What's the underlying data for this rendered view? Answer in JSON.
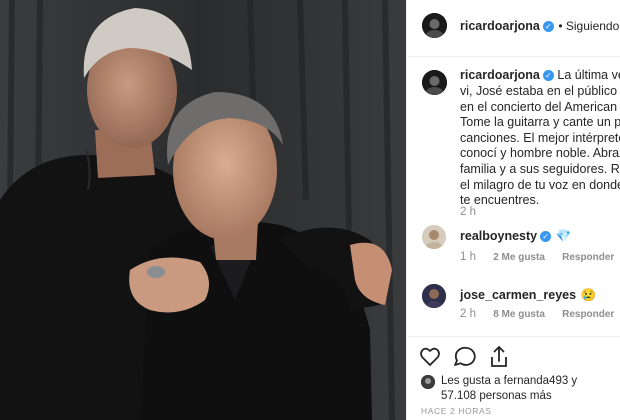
{
  "post": {
    "author": "ricardoarjona",
    "follow_status": "• Siguiendo",
    "caption_lines": [
      "La última vez que",
      "vi, José estaba en el público en M",
      "en el concierto del American Airli",
      "Tome la guitarra y cante un par d",
      "canciones. El mejor intérprete que",
      "conocí y hombre noble. Abrazo a",
      "familia y a sus seguidores. Recupe",
      "el milagro de tu voz en donde qu",
      "te encuentres."
    ],
    "caption_time": "2 h"
  },
  "comments": [
    {
      "user": "realboynesty",
      "emoji": "💎",
      "time": "1 h",
      "likes": "2 Me gusta",
      "reply": "Responder"
    },
    {
      "user": "jose_carmen_reyes",
      "emoji": "😢",
      "time": "2 h",
      "likes": "8 Me gusta",
      "reply": "Responder"
    }
  ],
  "actions": {
    "like_icon": "heart-icon",
    "comment_icon": "comment-icon",
    "share_icon": "share-icon"
  },
  "likes": {
    "line1": "Les gusta a fernanda493 y",
    "line2": "57.108 personas más"
  },
  "timestamp": "HACE 2 HORAS",
  "colors": {
    "verified": "#3897f0",
    "text": "#262626",
    "meta": "#8e8e8e"
  }
}
